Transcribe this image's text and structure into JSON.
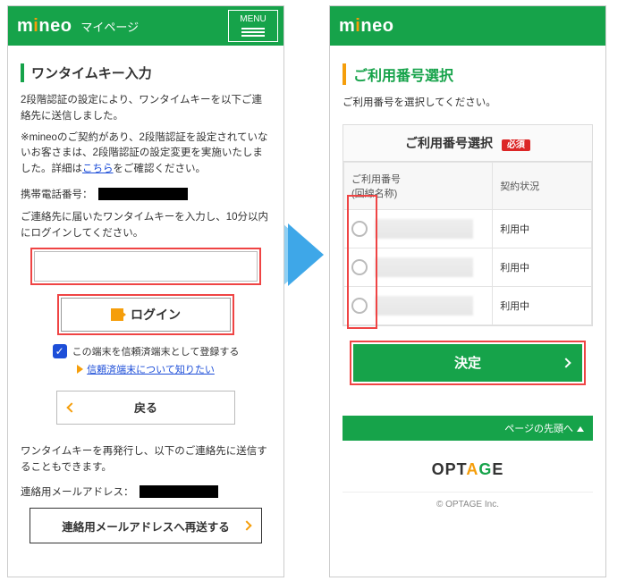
{
  "left": {
    "header": {
      "logo_pre": "m",
      "logo_post": "neo",
      "subpage": "マイページ",
      "menu": "MENU"
    },
    "title": "ワンタイムキー入力",
    "p1": "2段階認証の設定により、ワンタイムキーを以下ご連絡先に送信しました。",
    "p2_pre": "※mineoのご契約があり、2段階認証を設定されていないお客さまは、2段階認証の設定変更を実施いたしました。詳細は",
    "p2_link": "こちら",
    "p2_post": "をご確認ください。",
    "phone_label": "携帯電話番号：",
    "p3": "ご連絡先に届いたワンタイムキーを入力し、10分以内にログインしてください。",
    "login": "ログイン",
    "trust_chk": "この端末を信頼済端末として登録する",
    "trust_link": "信頼済端末について知りたい",
    "back": "戻る",
    "p4": "ワンタイムキーを再発行し、以下のご連絡先に送信することもできます。",
    "email_label": "連絡用メールアドレス：",
    "resend": "連絡用メールアドレスへ再送する"
  },
  "right": {
    "header": {
      "logo_pre": "m",
      "logo_post": "neo"
    },
    "title": "ご利用番号選択",
    "lead": "ご利用番号を選択してください。",
    "card_title": "ご利用番号選択",
    "required": "必須",
    "th_num": "ご利用番号",
    "th_num_sub": "(回線名称)",
    "th_status": "契約状況",
    "status": "利用中",
    "decide": "決定",
    "pagetop": "ページの先頭へ",
    "copy": "© OPTAGE Inc."
  }
}
